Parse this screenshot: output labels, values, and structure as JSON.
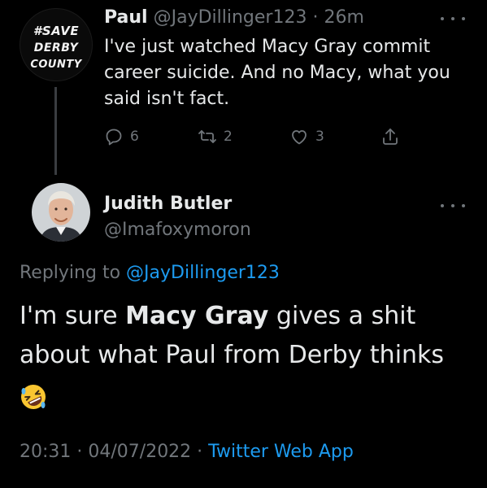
{
  "parent_tweet": {
    "avatar_badge_lines": [
      "#SAVE",
      "DERBY",
      "COUNTY"
    ],
    "name": "Paul",
    "handle": "@JayDillinger123",
    "separator": "·",
    "time": "26m",
    "text": "I've just watched Macy Gray commit career suicide. And no Macy, what you said isn't fact.",
    "reply_count": "6",
    "retweet_count": "2",
    "like_count": "3"
  },
  "reply_tweet": {
    "name": "Judith Butler",
    "handle": "@Imafoxymoron",
    "replying_prefix": "Replying to",
    "replying_to": "@JayDillinger123",
    "text_before": "I'm sure ",
    "text_bold": "Macy Gray",
    "text_after": " gives a shit about what Paul from Derby thinks",
    "emoji": "rolling-on-floor-laughing",
    "timestamp": "20:31 · 04/07/2022 ·",
    "source": "Twitter Web App"
  },
  "colors": {
    "background": "#000000",
    "text": "#e7e9ea",
    "muted": "#71767b",
    "link": "#1d9bf0"
  }
}
